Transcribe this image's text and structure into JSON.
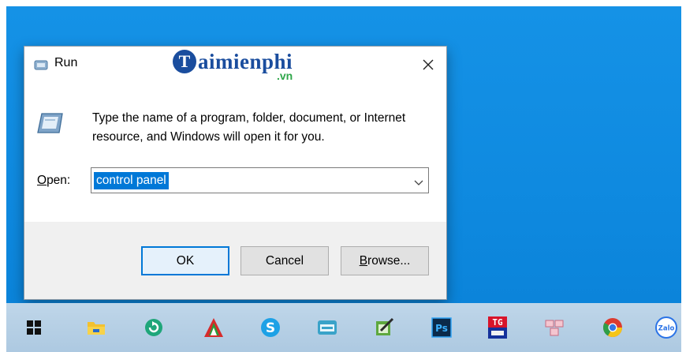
{
  "dialog": {
    "title": "Run",
    "logo_initial": "T",
    "logo_text": "aimienphi",
    "logo_suffix": ".vn",
    "description": "Type the name of a program, folder, document, or Internet resource, and Windows will open it for you.",
    "open_label_underlined": "O",
    "open_label_rest": "pen:",
    "open_value": "control panel",
    "ok_label": "OK",
    "cancel_label": "Cancel",
    "browse_label_underlined": "B",
    "browse_label_rest": "rowse...",
    "close_glyph": "✕"
  },
  "taskbar": {
    "items": [
      {
        "icon": "windows-start-icon"
      },
      {
        "icon": "file-explorer-icon"
      },
      {
        "icon": "green-app-icon"
      },
      {
        "icon": "red-triangle-app-icon"
      },
      {
        "icon": "skype-icon"
      },
      {
        "icon": "cloud-app-icon"
      },
      {
        "icon": "notepad-pencil-icon"
      },
      {
        "icon": "photoshop-icon",
        "text": "Ps"
      },
      {
        "icon": "tg-app-icon",
        "text": "TG"
      },
      {
        "icon": "grid-app-icon"
      },
      {
        "icon": "chrome-icon"
      },
      {
        "icon": "zalo-icon",
        "text": "Zalo"
      }
    ]
  },
  "colors": {
    "desktop": "#0f8ae0",
    "taskbar": "#b5cfe5",
    "selection": "#0078d7",
    "logo_blue": "#1a4d9e",
    "logo_green": "#2fa64a"
  }
}
